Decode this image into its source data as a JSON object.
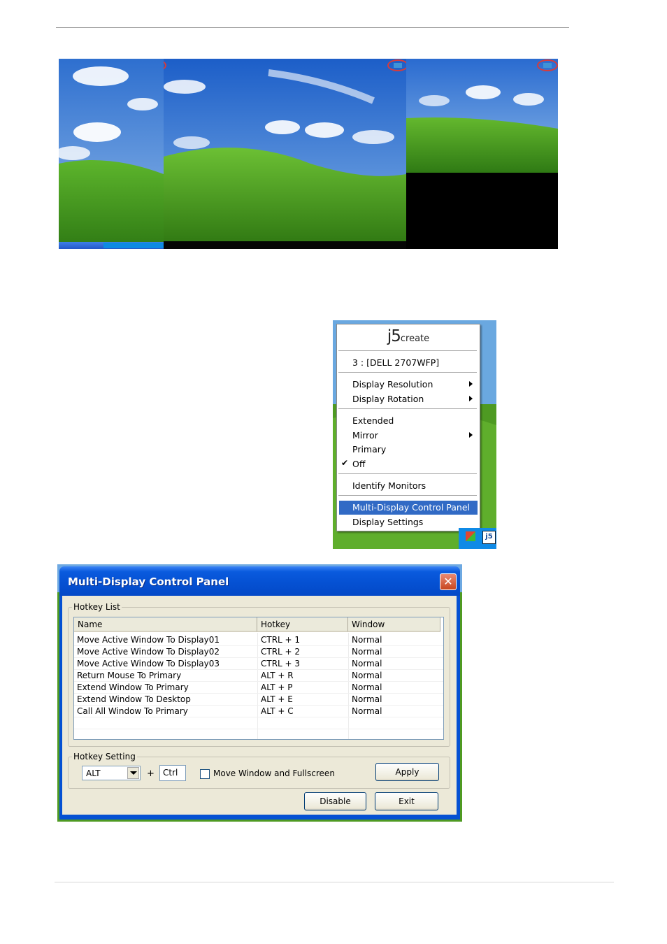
{
  "menu": {
    "logo_main": "j5",
    "logo_sub": "create",
    "device": "3 : [DELL 2707WFP]",
    "display_resolution": "Display Resolution",
    "display_rotation": "Display Rotation",
    "extended": "Extended",
    "mirror": "Mirror",
    "primary": "Primary",
    "off": "Off",
    "identify_monitors": "Identify Monitors",
    "control_panel": "Multi-Display Control Panel",
    "display_settings": "Display Settings",
    "checked_item": "Off",
    "highlighted_item": "Multi-Display Control Panel",
    "taskbar_icon_label": "j5"
  },
  "dialog": {
    "title": "Multi-Display Control Panel",
    "close_glyph": "✕",
    "hotkey_list_label": "Hotkey List",
    "columns": [
      "Name",
      "Hotkey",
      "Window"
    ],
    "rows": [
      [
        "Move Active Window To Display01",
        "CTRL + 1",
        "Normal"
      ],
      [
        "Move Active Window To Display02",
        "CTRL + 2",
        "Normal"
      ],
      [
        "Move Active Window To Display03",
        "CTRL + 3",
        "Normal"
      ],
      [
        "Return Mouse To Primary",
        "ALT + R",
        "Normal"
      ],
      [
        "Extend Window To Primary",
        "ALT + P",
        "Normal"
      ],
      [
        "Extend Window To Desktop",
        "ALT + E",
        "Normal"
      ],
      [
        "Call All Window To Primary",
        "ALT + C",
        "Normal"
      ]
    ],
    "hotkey_setting_label": "Hotkey Setting",
    "modifier_value": "ALT",
    "plus": "+",
    "key_value": "Ctrl",
    "fullscreen_label": "Move Window and Fullscreen",
    "fullscreen_checked": false,
    "apply_label": "Apply",
    "disable_label": "Disable",
    "exit_label": "Exit"
  },
  "colors": {
    "sky": "#2f6fd0",
    "grass": "#3f9a1f",
    "menu_highlight": "#316ac5",
    "xp_blue": "#0551d3",
    "dialog_face": "#ece9d8",
    "marker_red": "#d63c3c"
  }
}
